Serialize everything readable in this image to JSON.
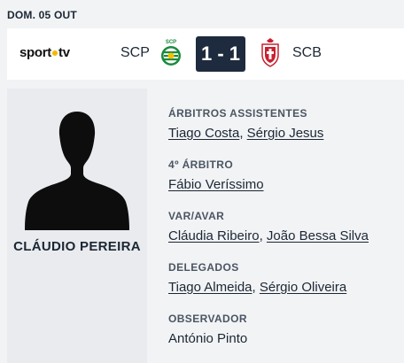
{
  "match": {
    "date": "DOM. 05 OUT",
    "broadcaster": {
      "left": "sport",
      "right": "tv"
    },
    "home_team": "SCP",
    "away_team": "SCB",
    "score": "1 - 1",
    "home_crest_text": "SCP",
    "colors": {
      "score_bg": "#1e2b3e",
      "home_green": "#1a8a3c",
      "away_red": "#c8202f"
    }
  },
  "referee": {
    "name": "CLÁUDIO PEREIRA",
    "photo_icon": "person-silhouette-icon"
  },
  "officials": {
    "assistants": {
      "title": "ÁRBITROS ASSISTENTES",
      "names": [
        "Tiago Costa",
        "Sérgio Jesus"
      ]
    },
    "fourth": {
      "title": "4º ÁRBITRO",
      "names": [
        "Fábio Veríssimo"
      ]
    },
    "var": {
      "title": "VAR/AVAR",
      "names": [
        "Cláudia Ribeiro",
        "João Bessa Silva"
      ]
    },
    "delegates": {
      "title": "DELEGADOS",
      "names": [
        "Tiago Almeida",
        "Sérgio Oliveira"
      ]
    },
    "observer": {
      "title": "OBSERVADOR",
      "names": [
        "António Pinto"
      ]
    }
  }
}
